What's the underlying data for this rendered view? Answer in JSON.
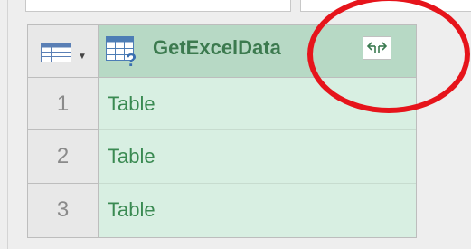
{
  "grid": {
    "corner": {
      "icon": "table-icon",
      "caret_icon": "chevron-down-icon"
    },
    "column": {
      "type_icon": "table-query-icon",
      "name": "GetExcelData",
      "expand_icon": "expand-columns-icon"
    },
    "rows": [
      {
        "num": "1",
        "value": "Table"
      },
      {
        "num": "2",
        "value": "Table"
      },
      {
        "num": "3",
        "value": "Table"
      }
    ]
  },
  "colors": {
    "header_bg": "#b7d9c5",
    "cell_bg": "#d8efe2",
    "cell_text": "#3a8a52",
    "highlight_circle": "#e6141b"
  }
}
